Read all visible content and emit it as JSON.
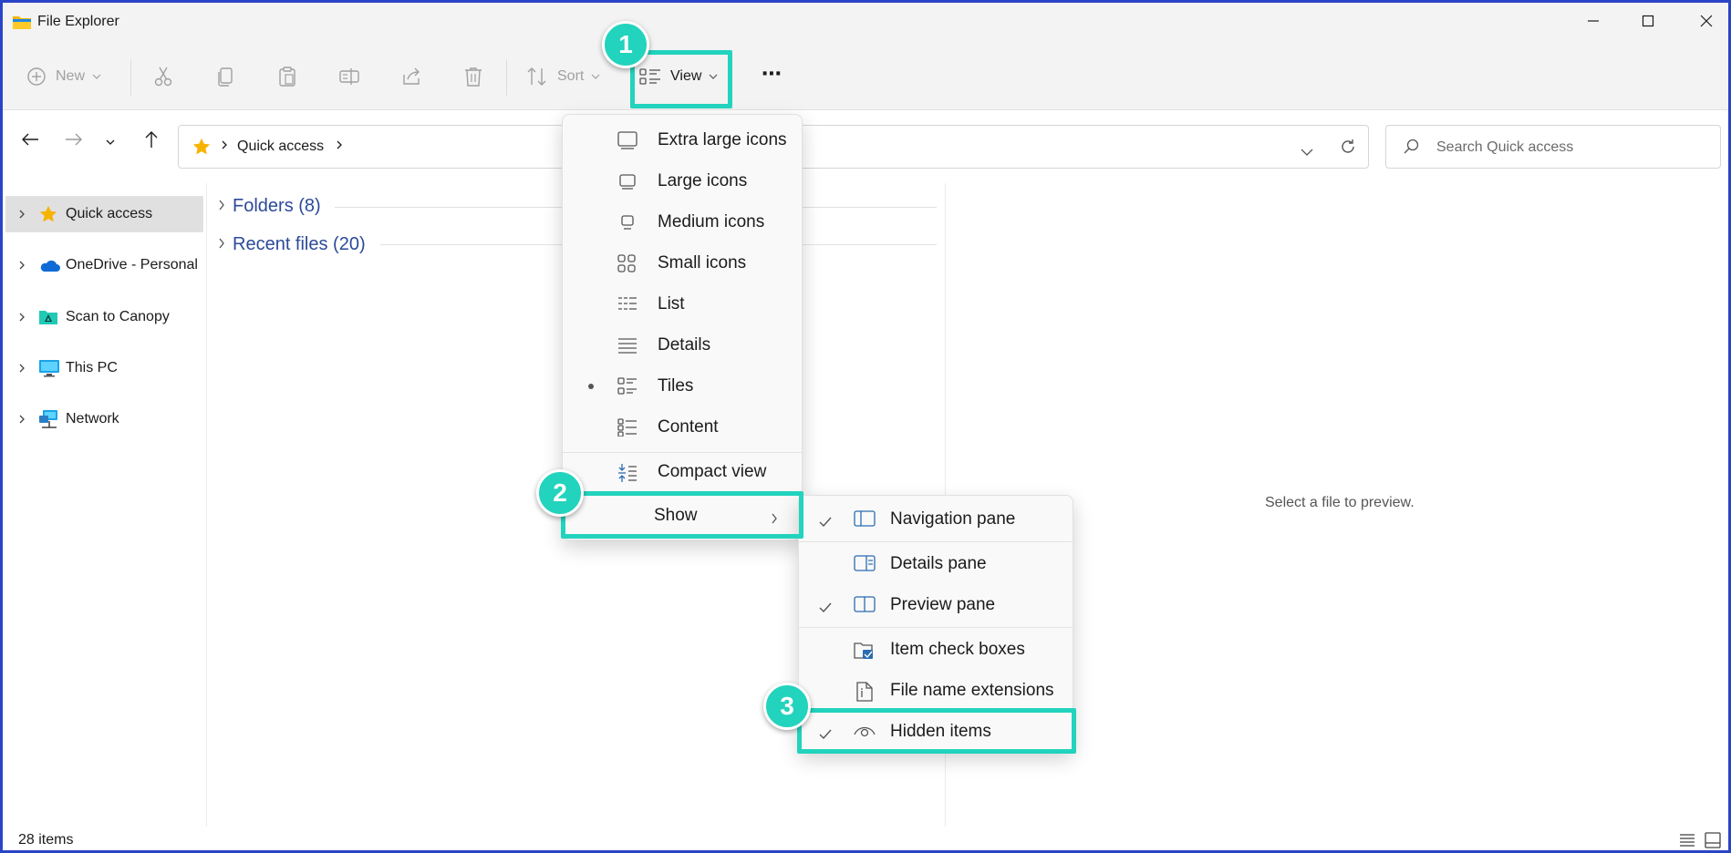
{
  "window": {
    "title": "File Explorer"
  },
  "toolbar": {
    "new_label": "New",
    "sort_label": "Sort",
    "view_label": "View",
    "more_label": "⋯"
  },
  "address": {
    "crumbs": [
      "Quick access"
    ],
    "search_placeholder": "Search Quick access"
  },
  "nav": {
    "items": [
      {
        "label": "Quick access",
        "icon": "star-icon",
        "selected": true
      },
      {
        "label": "OneDrive - Personal",
        "icon": "cloud-icon"
      },
      {
        "label": "Scan to Canopy",
        "icon": "canopy-folder-icon"
      },
      {
        "label": "This PC",
        "icon": "monitor-icon"
      },
      {
        "label": "Network",
        "icon": "network-icon"
      }
    ]
  },
  "content": {
    "groups": [
      {
        "label": "Folders (8)"
      },
      {
        "label": "Recent files (20)"
      }
    ],
    "preview_text": "Select a file to preview."
  },
  "status": {
    "count": "28 items"
  },
  "view_menu": {
    "items": [
      {
        "label": "Extra large icons",
        "icon": "extra-large-icons-icon"
      },
      {
        "label": "Large icons",
        "icon": "large-icons-icon"
      },
      {
        "label": "Medium icons",
        "icon": "medium-icons-icon"
      },
      {
        "label": "Small icons",
        "icon": "small-icons-icon"
      },
      {
        "label": "List",
        "icon": "list-icon"
      },
      {
        "label": "Details",
        "icon": "details-icon"
      },
      {
        "label": "Tiles",
        "icon": "tiles-icon",
        "selected": true
      },
      {
        "label": "Content",
        "icon": "content-icon"
      },
      {
        "label": "Compact view",
        "icon": "compact-view-icon"
      },
      {
        "label": "Show",
        "icon": "chevron-right-icon"
      }
    ]
  },
  "show_menu": {
    "items": [
      {
        "label": "Navigation pane",
        "checked": true,
        "icon": "navigation-pane-icon"
      },
      {
        "label": "Details pane",
        "checked": false,
        "icon": "details-pane-icon"
      },
      {
        "label": "Preview pane",
        "checked": true,
        "icon": "preview-pane-icon"
      },
      {
        "label": "Item check boxes",
        "checked": false,
        "icon": "item-check-boxes-icon"
      },
      {
        "label": "File name extensions",
        "checked": false,
        "icon": "file-extensions-icon"
      },
      {
        "label": "Hidden items",
        "checked": true,
        "icon": "eye-icon"
      }
    ]
  },
  "callouts": [
    {
      "number": "1"
    },
    {
      "number": "2"
    },
    {
      "number": "3"
    }
  ],
  "colors": {
    "accent_highlight": "#22d3bd",
    "window_border": "#2a44c7",
    "group_text": "#2b4a9a"
  }
}
